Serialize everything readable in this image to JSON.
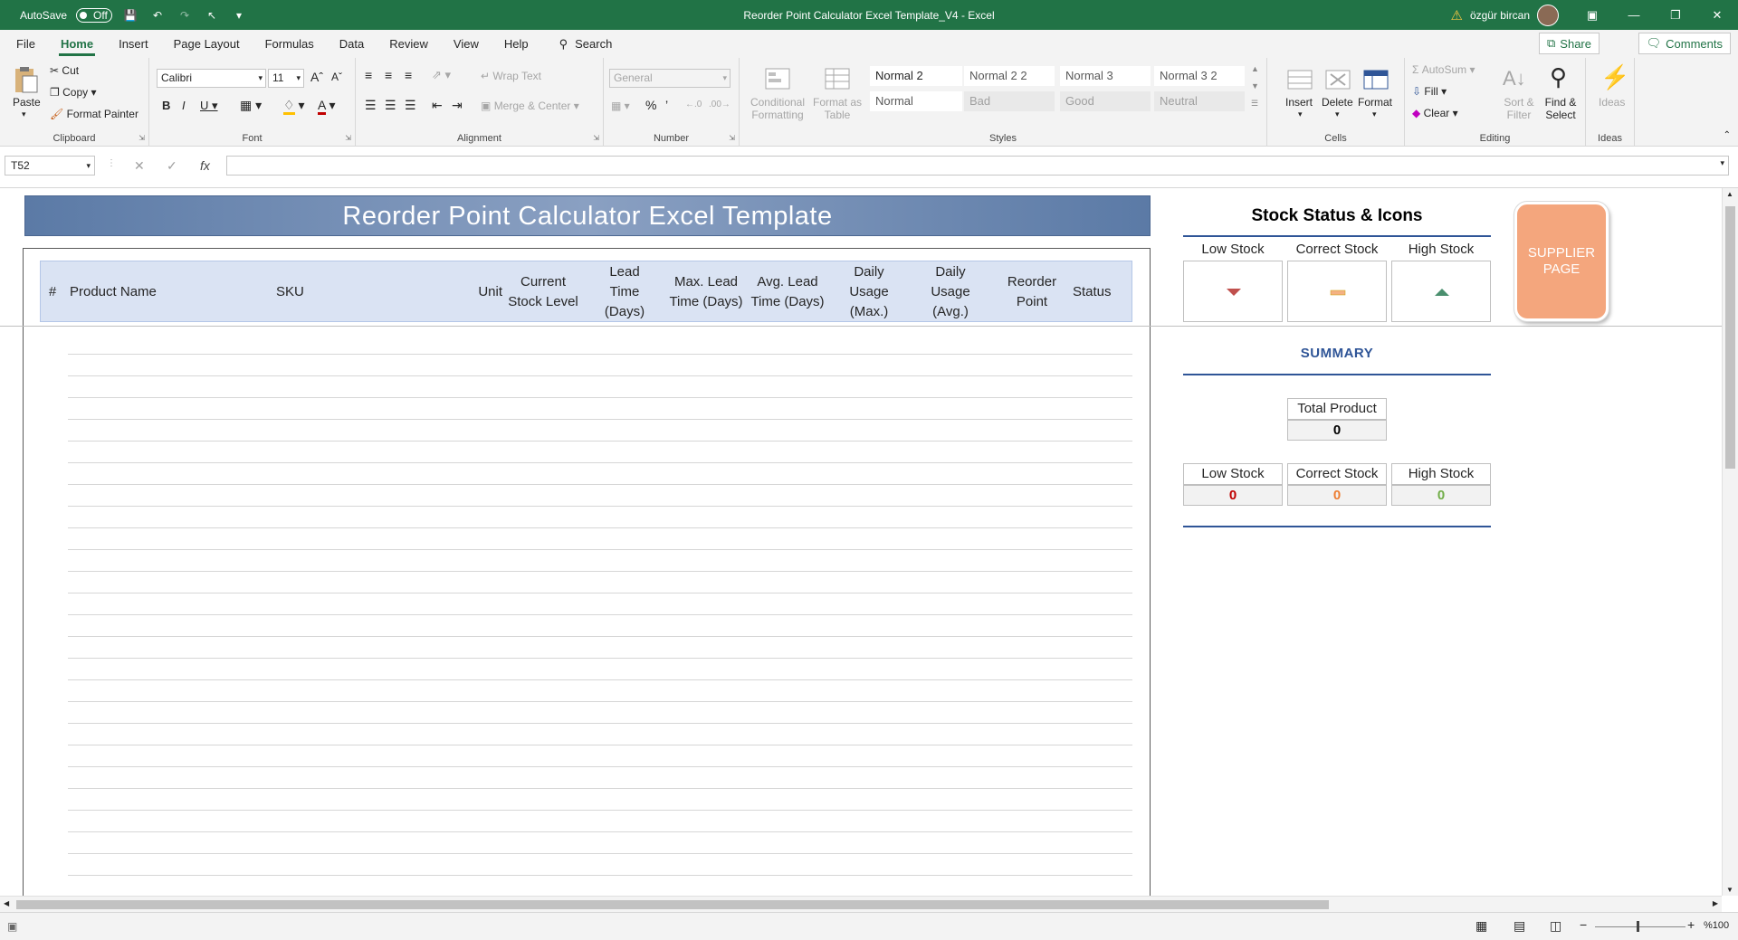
{
  "window": {
    "autosave_label": "AutoSave",
    "autosave_state": "Off",
    "title": "Reorder Point Calculator Excel Template_V4  -  Excel",
    "user_name": "özgür bircan"
  },
  "menu": {
    "tabs": [
      "File",
      "Home",
      "Insert",
      "Page Layout",
      "Formulas",
      "Data",
      "Review",
      "View",
      "Help"
    ],
    "search_label": "Search",
    "share_label": "Share",
    "comments_label": "Comments"
  },
  "ribbon": {
    "clipboard": {
      "paste": "Paste",
      "cut": "Cut",
      "copy": "Copy",
      "format_painter": "Format Painter",
      "label": "Clipboard"
    },
    "font": {
      "name": "Calibri",
      "size": "11",
      "label": "Font"
    },
    "alignment": {
      "wrap_text": "Wrap Text",
      "merge_center": "Merge & Center",
      "label": "Alignment"
    },
    "number": {
      "format": "General",
      "label": "Number"
    },
    "styles": {
      "conditional": "Conditional Formatting",
      "format_as_table": "Format as Table",
      "cells": [
        "Normal 2",
        "Normal 2 2",
        "Normal 3",
        "Normal 3 2",
        "Normal",
        "Bad",
        "Good",
        "Neutral"
      ],
      "label": "Styles"
    },
    "cells": {
      "insert": "Insert",
      "delete": "Delete",
      "format": "Format",
      "label": "Cells"
    },
    "editing": {
      "autosum": "AutoSum",
      "fill": "Fill",
      "clear": "Clear",
      "sort_filter": "Sort & Filter",
      "find_select": "Find & Select",
      "label": "Editing"
    },
    "ideas": {
      "ideas": "Ideas",
      "label": "Ideas"
    }
  },
  "formula_bar": {
    "name_box": "T52",
    "fx": "fx",
    "value": ""
  },
  "sheet": {
    "banner_title": "Reorder Point Calculator Excel Template",
    "columns": [
      "#",
      "Product Name",
      "SKU",
      "Unit",
      "Current Stock Level",
      "Lead Time (Days)",
      "Max. Lead Time (Days)",
      "Avg. Lead Time (Days)",
      "Daily Usage (Max.)",
      "Daily Usage (Avg.)",
      "Reorder Point",
      "Status"
    ],
    "stock_status": {
      "title": "Stock Status & Icons",
      "labels": [
        "Low Stock",
        "Correct Stock",
        "High Stock"
      ],
      "colors": {
        "low": "#c0504d",
        "correct": "#f4b183",
        "high": "#4a8f6e"
      }
    },
    "supplier_button": "SUPPLIER PAGE",
    "summary": {
      "title": "SUMMARY",
      "total_label": "Total Product",
      "total_value": "0",
      "low_label": "Low Stock",
      "low_value": "0",
      "correct_label": "Correct Stock",
      "correct_value": "0",
      "high_label": "High Stock",
      "high_value": "0"
    }
  },
  "status_bar": {
    "zoom": "%100"
  }
}
